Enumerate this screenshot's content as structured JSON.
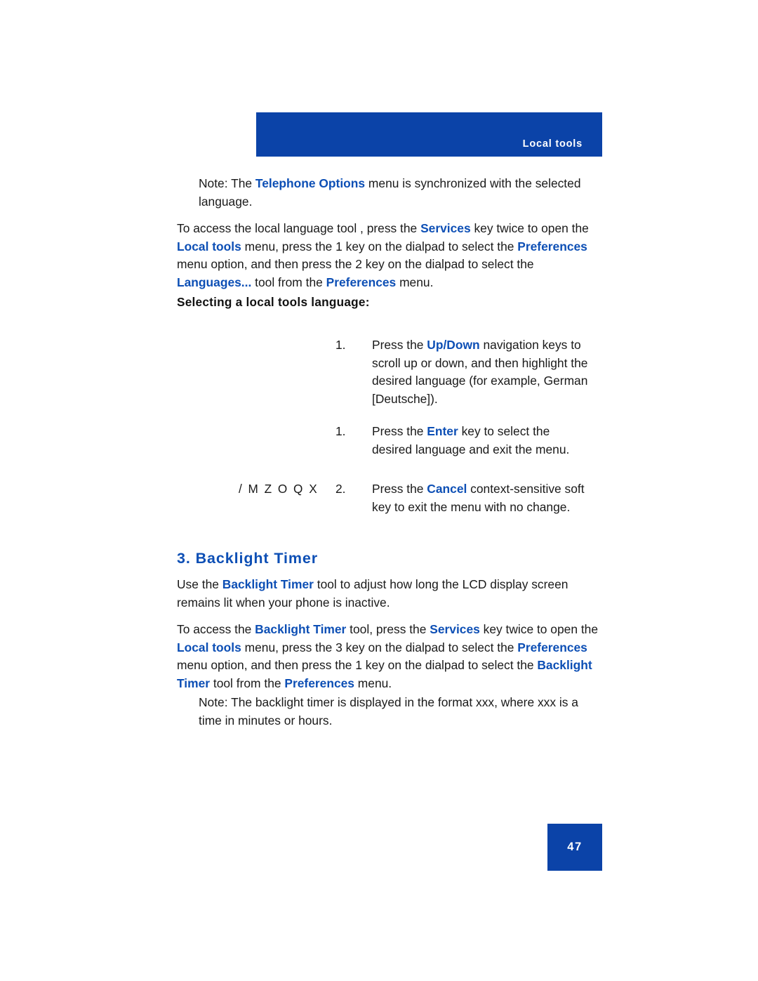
{
  "header": {
    "label": "Local tools",
    "band_color": "#0B43A8"
  },
  "theme": {
    "accent_blue": "#0D4FB5",
    "band_blue": "#0B43A8",
    "body_text": "#1a1a1a"
  },
  "body": {
    "note_1": {
      "prefix": "Note:  The ",
      "kw_1": "Telephone Options",
      "rest": " menu is synchronized with the selected language."
    },
    "para_access": {
      "t1": "To access the local language tool , press the ",
      "kw1": "Services",
      "t2": " key twice to open the ",
      "kw2": "Local tools",
      "t3": " menu, press the 1 key on the dialpad to select the ",
      "kw3": "Preferences",
      "t4": " menu option, and then press the 2 key on the dialpad to select the ",
      "kw4": "Languages...",
      "t5": " tool from the ",
      "kw5": "Preferences",
      "t6": " menu."
    },
    "sub_head": "Selecting a local tools language:",
    "steps": [
      {
        "number": "1.",
        "t1": "Press the ",
        "kw1": "Up/Down",
        "t2": " navigation keys to scroll up or down, and then highlight the desired language (for example, German [Deutsche])."
      },
      {
        "number": "1.",
        "t1": "Press the ",
        "kw1": "Enter",
        "t2": " key to select the desired language and exit the menu."
      },
      {
        "number": "2.",
        "t1": "Press the ",
        "kw1": "Cancel",
        "t2": " context-sensitive soft key to exit the menu with no change."
      }
    ],
    "glyph_run": "/ M Z O Q X",
    "section_heading": "3. Backlight Timer",
    "para_use": {
      "t1": "Use the ",
      "kw1": "Backlight Timer",
      "t2": " tool to adjust how long the LCD display screen remains lit when your phone is inactive."
    },
    "para_access2": {
      "t1": "To access the ",
      "kw1": "Backlight Timer",
      "t2": " tool, press the ",
      "kw2": "Services",
      "t3": " key twice to open the ",
      "kw3": "Local tools",
      "t4": " menu, press the 3 key on the dialpad to select the ",
      "kw4": "Preferences",
      "t5": " menu option, and then press the 1 key on the dialpad to select the ",
      "kw5": "Backlight Timer",
      "t6": " tool from the ",
      "kw6": "Preferences",
      "t7": " menu."
    },
    "note_2": "Note:  The backlight timer is displayed in the format xxx, where xxx is a time in minutes or hours."
  },
  "footer": {
    "page_number": "47"
  }
}
